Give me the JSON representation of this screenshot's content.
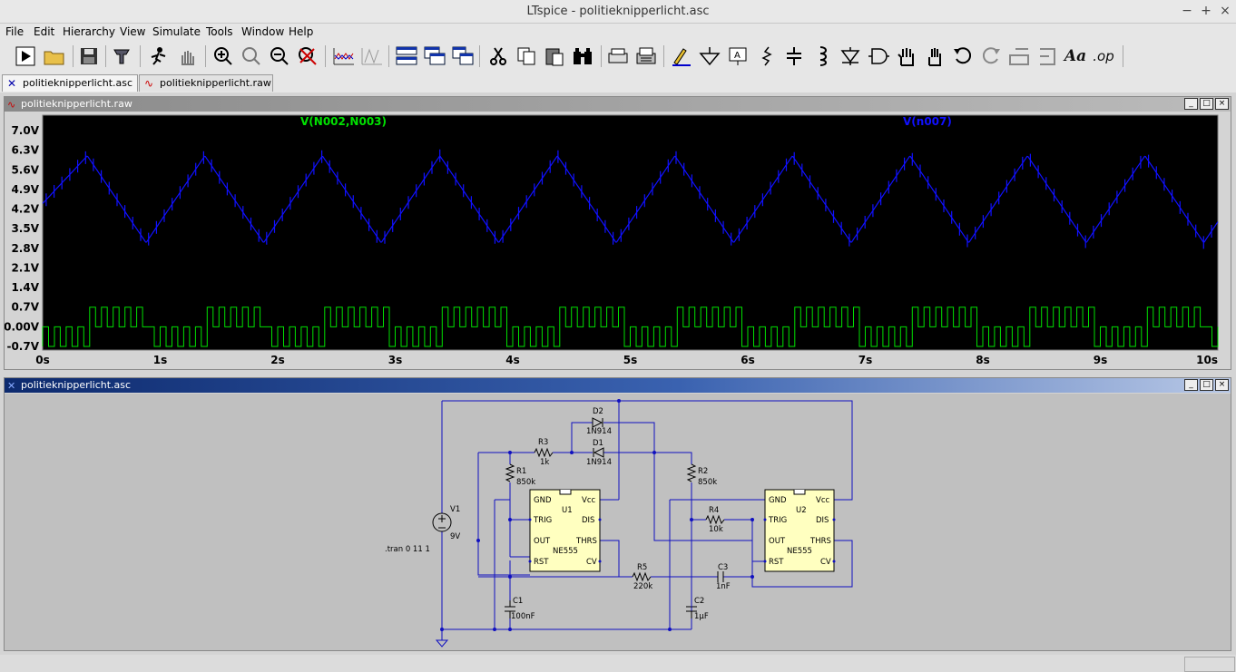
{
  "window": {
    "title": "LTspice - politieknipperlicht.asc",
    "minimize": "−",
    "maximize": "+",
    "close": "×"
  },
  "menu": [
    "File",
    "Edit",
    "Hierarchy",
    "View",
    "Simulate",
    "Tools",
    "Window",
    "Help"
  ],
  "toolbar": {
    "icons": [
      "run-icon",
      "open-icon",
      "save-icon",
      "control-panel-icon",
      "halt-icon",
      "pan-icon",
      "zoom-in-icon",
      "zoom-full-icon",
      "zoom-out-icon",
      "autorange-icon",
      "waveform-window-icon",
      "waveform-2-icon",
      "tile-horizontal-icon",
      "cascade-icon",
      "tile-vertical-icon",
      "cut-icon",
      "copy-icon",
      "paste-icon",
      "find-icon",
      "print-preview-icon",
      "print-icon",
      "draw-wire-icon",
      "ground-icon",
      "label-net-icon",
      "resistor-icon",
      "capacitor-icon",
      "inductor-icon",
      "diode-icon",
      "component-icon",
      "move-icon",
      "drag-icon",
      "undo-icon",
      "redo-icon",
      "rotate-icon",
      "mirror-icon",
      "text-icon",
      "spice-directive-icon"
    ],
    "text_text": "Aa",
    "op_text": ".op"
  },
  "tabs": [
    {
      "label": "politieknipperlicht.asc",
      "active": true
    },
    {
      "label": "politieknipperlicht.raw",
      "active": false
    }
  ],
  "waveform_pane": {
    "title": "politieknipperlicht.raw",
    "controls": [
      "_",
      "□",
      "×"
    ]
  },
  "schematic_pane": {
    "title": "politieknipperlicht.asc",
    "controls": [
      "_",
      "□",
      "×"
    ]
  },
  "chart_data": {
    "type": "line",
    "series": [
      {
        "name": "V(N002,N003)",
        "color": "#00e000"
      },
      {
        "name": "V(n007)",
        "color": "#1010ff"
      }
    ],
    "y_ticks": [
      "7.0V",
      "6.3V",
      "5.6V",
      "4.9V",
      "4.2V",
      "3.5V",
      "2.8V",
      "2.1V",
      "1.4V",
      "0.7V",
      "0.00V",
      "-0.7V"
    ],
    "x_ticks": [
      "0s",
      "1s",
      "2s",
      "3s",
      "4s",
      "5s",
      "6s",
      "7s",
      "8s",
      "9s",
      "10s"
    ],
    "xlim": [
      0,
      10
    ],
    "ylim": [
      -0.7,
      7.0
    ],
    "background": "#000000",
    "triangle": {
      "min": 3.0,
      "max": 6.1,
      "period": 1.0,
      "first_peak": 0.38,
      "start": 4.4
    },
    "square": {
      "high": 0.7,
      "low": 0.0,
      "min": -0.7,
      "burst_period": 1.0,
      "burst_high_start": 0.38,
      "burst_high_end": 0.9
    }
  },
  "schematic": {
    "components": [
      {
        "ref": "D2",
        "value": "1N914"
      },
      {
        "ref": "D1",
        "value": "1N914"
      },
      {
        "ref": "R3",
        "value": "1k"
      },
      {
        "ref": "R1",
        "value": "850k"
      },
      {
        "ref": "R2",
        "value": "850k"
      },
      {
        "ref": "R4",
        "value": "10k"
      },
      {
        "ref": "R5",
        "value": "220k"
      },
      {
        "ref": "C1",
        "value": "100nF"
      },
      {
        "ref": "C2",
        "value": "1µF"
      },
      {
        "ref": "C3",
        "value": "1nF"
      },
      {
        "ref": "V1",
        "value": "9V"
      },
      {
        "ref": "U1",
        "value": "NE555"
      },
      {
        "ref": "U2",
        "value": "NE555"
      }
    ],
    "pins_left": [
      "GND",
      "TRIG",
      "OUT",
      "RST"
    ],
    "pins_right": [
      "Vcc",
      "DIS",
      "THRS",
      "CV"
    ],
    "directive": ".tran 0 11 1"
  }
}
